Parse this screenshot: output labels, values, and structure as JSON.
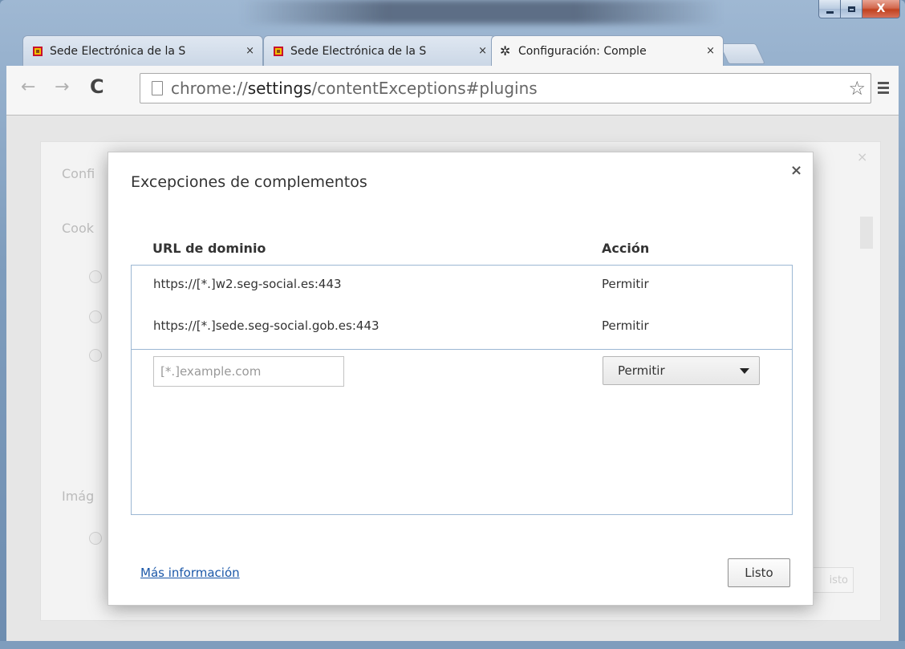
{
  "tabs": [
    {
      "title": "Sede Electrónica de la S",
      "close": "×",
      "icon": "spanish-coat-of-arms-icon"
    },
    {
      "title": "Sede Electrónica de la S",
      "close": "×",
      "icon": "spanish-coat-of-arms-icon"
    },
    {
      "title": "Configuración: Comple",
      "close": "×",
      "icon": "gear-icon"
    }
  ],
  "toolbar": {
    "back": "←",
    "forward": "→",
    "reload": "C",
    "url_scheme": "chrome://",
    "url_host": "settings",
    "url_path": "/contentExceptions#plugins",
    "star": "☆"
  },
  "background": {
    "title_fragment": "Confi",
    "cookies_fragment": "Cook",
    "images_fragment": "Imág",
    "button_fragment": "isto",
    "close": "×"
  },
  "dialog": {
    "title": "Excepciones de complementos",
    "close": "×",
    "col_url": "URL de dominio",
    "col_action": "Acción",
    "rows": [
      {
        "url": "https://[*.]w2.seg-social.es:443",
        "action": "Permitir"
      },
      {
        "url": "https://[*.]sede.seg-social.gob.es:443",
        "action": "Permitir"
      }
    ],
    "new_url_placeholder": "[*.]example.com",
    "new_action": "Permitir",
    "more_info": "Más información",
    "done": "Listo"
  },
  "colors": {
    "link": "#1a57a8",
    "list_border": "#9cb7d3"
  }
}
